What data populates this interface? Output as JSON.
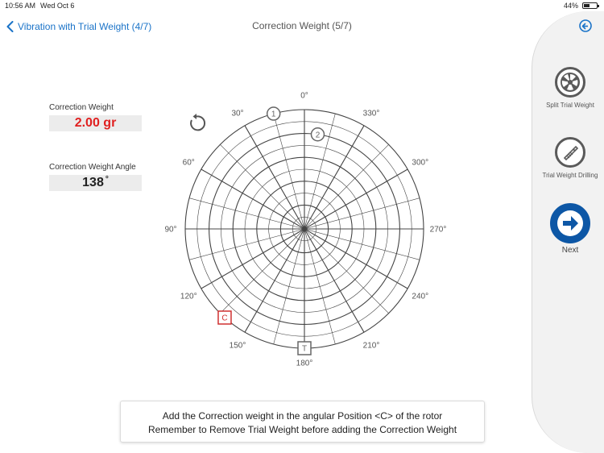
{
  "statusbar": {
    "time": "10:56 AM",
    "date": "Wed Oct 6",
    "battery": "44%",
    "battery_level": 0.44
  },
  "nav": {
    "back_label": "Vibration with Trial Weight (4/7)",
    "title": "Correction Weight (5/7)"
  },
  "fields": {
    "correction_weight_label": "Correction Weight",
    "correction_weight_value": "2.00 gr",
    "correction_weight_angle_label": "Correction Weight Angle",
    "correction_weight_angle_value": "138",
    "degree_symbol": "°"
  },
  "polar": {
    "angle_labels": [
      "0°",
      "30°",
      "60°",
      "90°",
      "120°",
      "150°",
      "180°",
      "210°",
      "240°",
      "270°",
      "300°",
      "330°"
    ],
    "ring_count": 10,
    "spoke_count": 24,
    "direction": "counter-clockwise",
    "markers": [
      {
        "label": "1",
        "angle": 15,
        "radius_fraction": 1.0,
        "shape": "circle",
        "color": "#666666"
      },
      {
        "label": "2",
        "angle": 352,
        "radius_fraction": 0.8,
        "shape": "circle",
        "color": "#666666"
      },
      {
        "label": "T",
        "angle": 180,
        "radius_fraction": 1.0,
        "shape": "square",
        "color": "#666666"
      },
      {
        "label": "C",
        "angle": 138,
        "radius_fraction": 1.0,
        "shape": "square",
        "color": "#d03030"
      }
    ]
  },
  "side": {
    "split_label": "Split Trial Weight",
    "drill_label": "Trial Weight Drilling",
    "next_label": "Next"
  },
  "message": {
    "line1": "Add the Correction weight in the angular Position <C> of the rotor",
    "line2": "Remember to Remove Trial Weight before adding the Correction Weight"
  },
  "colors": {
    "accent": "#1a73c8",
    "next_button": "#0d57a6",
    "value_red": "#e02020",
    "grid": "#444444"
  }
}
